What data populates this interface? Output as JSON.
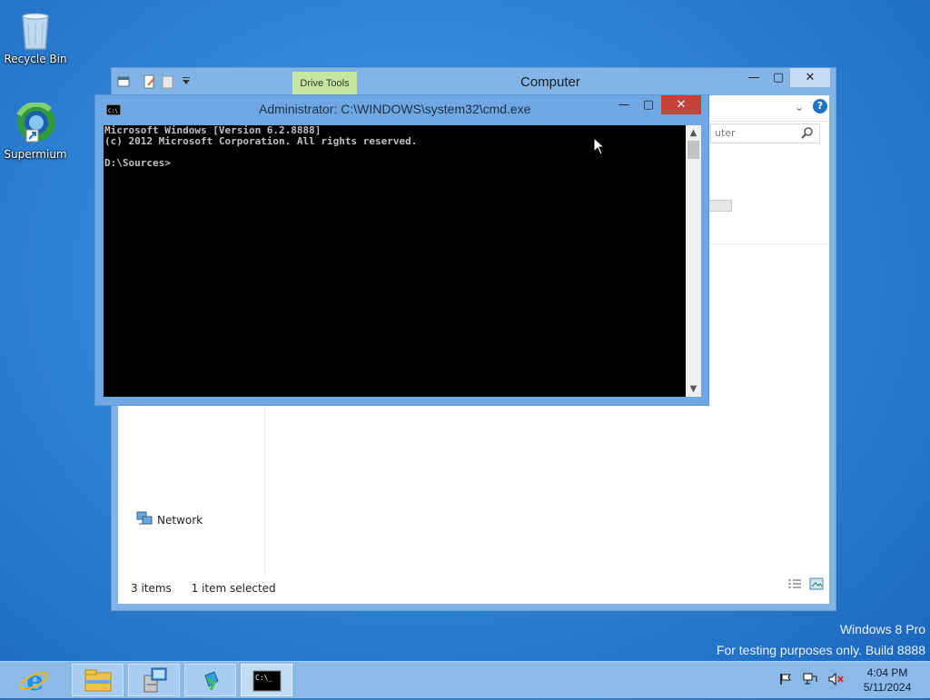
{
  "desktop": {
    "icons": [
      {
        "label": "Recycle Bin",
        "icon": "recycle-bin-icon"
      },
      {
        "label": "Supermium",
        "icon": "supermium-icon"
      }
    ],
    "watermark": {
      "line1": "Windows 8 Pro",
      "line2": "For testing purposes only. Build 8888"
    }
  },
  "explorer": {
    "title": "Computer",
    "contextual_tab": "Drive Tools",
    "search_placeholder": "uter",
    "nav_items": [
      {
        "label": "Network",
        "icon": "network-icon"
      }
    ],
    "status": {
      "items": "3 items",
      "selected": "1 item selected"
    },
    "controls": {
      "minimize": "—",
      "maximize": "▢",
      "close": "✕"
    }
  },
  "cmd": {
    "title": "Administrator: C:\\WINDOWS\\system32\\cmd.exe",
    "console_text": "Microsoft Windows [Version 6.2.8888]\n(c) 2012 Microsoft Corporation. All rights reserved.\n\nD:\\Sources>",
    "controls": {
      "minimize": "—",
      "maximize": "▢",
      "close": "✕"
    }
  },
  "taskbar": {
    "apps": [
      {
        "name": "Internet Explorer",
        "icon": "internet-explorer-icon",
        "state": "pinned"
      },
      {
        "name": "File Explorer",
        "icon": "file-explorer-icon",
        "state": "open"
      },
      {
        "name": "Setup",
        "icon": "setup-package-icon",
        "state": "open"
      },
      {
        "name": "Network Installer",
        "icon": "installer-icon",
        "state": "open"
      },
      {
        "name": "Command Prompt",
        "icon": "command-prompt-icon",
        "state": "active"
      }
    ],
    "tray": {
      "icons": [
        "action-center-flag-icon",
        "network-status-icon",
        "volume-muted-icon"
      ],
      "time": "4:04 PM",
      "date": "5/11/2024"
    }
  },
  "colors": {
    "cmd_frame": "#6ea7e3",
    "close_red": "#c7413b",
    "drive_tools_green": "#c6e7a0",
    "taskbar": "#8bb9e8"
  }
}
